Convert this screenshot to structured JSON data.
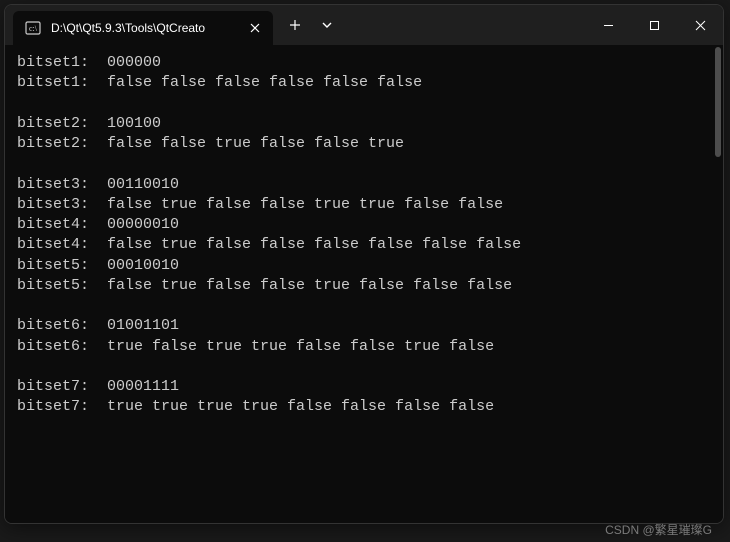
{
  "window": {
    "title": "D:\\Qt\\Qt5.9.3\\Tools\\QtCreato"
  },
  "output": {
    "lines": [
      "bitset1:  000000",
      "bitset1:  false false false false false false",
      "",
      "bitset2:  100100",
      "bitset2:  false false true false false true",
      "",
      "bitset3:  00110010",
      "bitset3:  false true false false true true false false",
      "bitset4:  00000010",
      "bitset4:  false true false false false false false false",
      "bitset5:  00010010",
      "bitset5:  false true false false true false false false",
      "",
      "bitset6:  01001101",
      "bitset6:  true false true true false false true false",
      "",
      "bitset7:  00001111",
      "bitset7:  true true true true false false false false"
    ]
  },
  "watermark": "CSDN @繁星璀璨G"
}
